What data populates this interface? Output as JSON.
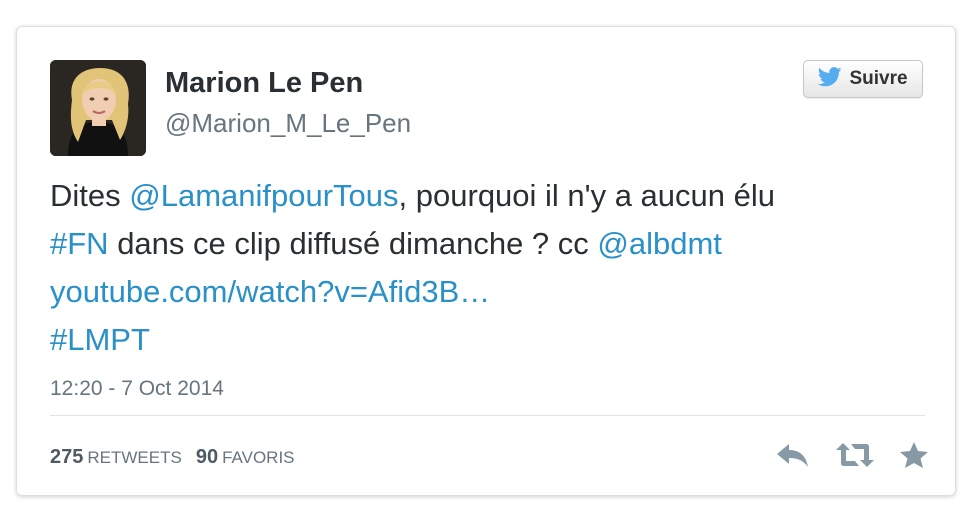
{
  "tweet": {
    "author_name": "Marion Le Pen",
    "author_handle": "@Marion_M_Le_Pen",
    "follow_label": "Suivre",
    "text_lines": [
      [
        {
          "text": "Dites ",
          "link": false
        },
        {
          "text": "@LamanifpourTous",
          "link": true
        },
        {
          "text": ", pourquoi il n'y a aucun élu",
          "link": false
        }
      ],
      [
        {
          "text": "#FN",
          "link": true
        },
        {
          "text": " dans ce clip diffusé dimanche ? cc ",
          "link": false
        },
        {
          "text": "@albdmt",
          "link": true
        }
      ],
      [
        {
          "text": "youtube.com/watch?v=Afid3B…",
          "link": true
        }
      ],
      [
        {
          "text": "#LMPT",
          "link": true
        }
      ]
    ],
    "timestamp": "12:20 - 7 Oct 2014",
    "stats": {
      "retweets_count": "275",
      "retweets_label": "RETWEETS",
      "favorites_count": "90",
      "favorites_label": "FAVORIS"
    },
    "actions": {
      "reply_icon": "reply-icon",
      "retweet_icon": "retweet-icon",
      "favorite_icon": "star-icon"
    }
  },
  "colors": {
    "link": "#2a90c8",
    "text": "#292f33",
    "secondary": "#66757f",
    "twitter_bird": "#55acee",
    "action_icon": "#8899a6"
  }
}
